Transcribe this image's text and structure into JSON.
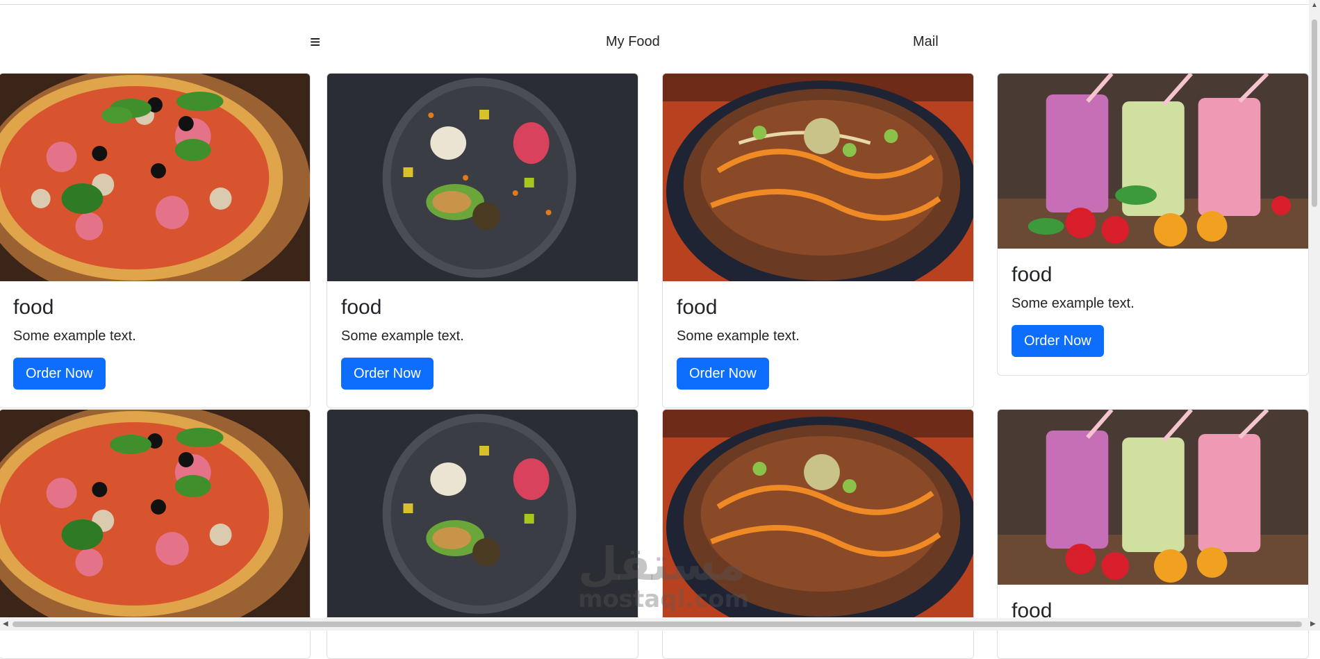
{
  "nav": {
    "menu_icon": "hamburger-icon",
    "menu_glyph": "≡",
    "links": [
      "My Food",
      "Mail"
    ]
  },
  "cards": [
    {
      "image": "pizza-image",
      "title": "food",
      "text": "Some example text.",
      "button": "Order Now"
    },
    {
      "image": "plated-dish-image",
      "title": "food",
      "text": "Some example text.",
      "button": "Order Now"
    },
    {
      "image": "beef-stir-fry-image",
      "title": "food",
      "text": "Some example text.",
      "button": "Order Now"
    },
    {
      "image": "smoothies-image",
      "title": "food",
      "text": "Some example text.",
      "button": "Order Now"
    },
    {
      "image": "pizza-image",
      "title": "",
      "text": "",
      "button": ""
    },
    {
      "image": "plated-dish-image",
      "title": "",
      "text": "",
      "button": ""
    },
    {
      "image": "beef-stir-fry-image",
      "title": "",
      "text": "",
      "button": ""
    },
    {
      "image": "smoothies-image",
      "title": "food",
      "text": "",
      "button": ""
    }
  ],
  "watermark": {
    "arabic": "مستقل",
    "latin": "mostaql.com"
  },
  "colors": {
    "button": "#0d6efd",
    "card_border": "#dfdfdf"
  }
}
